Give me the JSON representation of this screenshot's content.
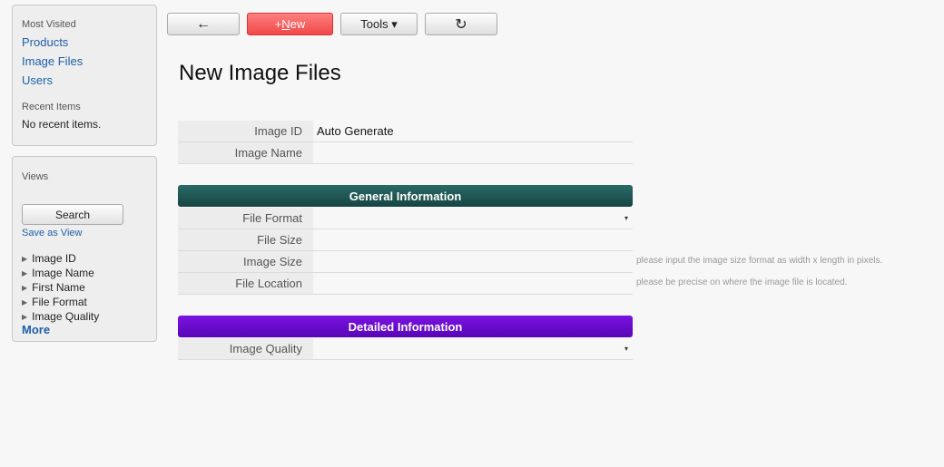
{
  "sidebar": {
    "most_visited_label": "Most Visited",
    "links": [
      "Products",
      "Image Files",
      "Users"
    ],
    "recent_label": "Recent Items",
    "recent_empty": "No recent items.",
    "views_label": "Views",
    "search_button": "Search",
    "save_as_view": "Save as View",
    "view_items": [
      "Image ID",
      "Image Name",
      "First Name",
      "File Format",
      "Image Quality"
    ],
    "more": "More"
  },
  "toolbar": {
    "back_icon": "←",
    "new_plus": "+",
    "new_underlined": "N",
    "new_rest": "ew",
    "tools": "Tools ▾",
    "refresh_icon": "↻"
  },
  "page_title": "New Image Files",
  "fields": {
    "image_id": {
      "label": "Image ID",
      "value": "Auto Generate"
    },
    "image_name": {
      "label": "Image Name",
      "value": ""
    }
  },
  "general": {
    "header": "General Information",
    "file_format": {
      "label": "File Format",
      "value": ""
    },
    "file_size": {
      "label": "File Size",
      "value": ""
    },
    "image_size": {
      "label": "Image Size",
      "value": "",
      "hint": "please input the image size format as width x length in pixels."
    },
    "file_location": {
      "label": "File Location",
      "value": "",
      "hint": "please be precise on where the image file is located."
    }
  },
  "detailed": {
    "header": "Detailed Information",
    "image_quality": {
      "label": "Image Quality",
      "value": ""
    }
  },
  "icons": {
    "dropdown": "▾",
    "tree_toggle": "▶"
  },
  "colors": {
    "new_button": "#f04848",
    "general_header": "#1d5553",
    "detailed_header": "#6a0bd1",
    "link": "#1d5fa6"
  }
}
